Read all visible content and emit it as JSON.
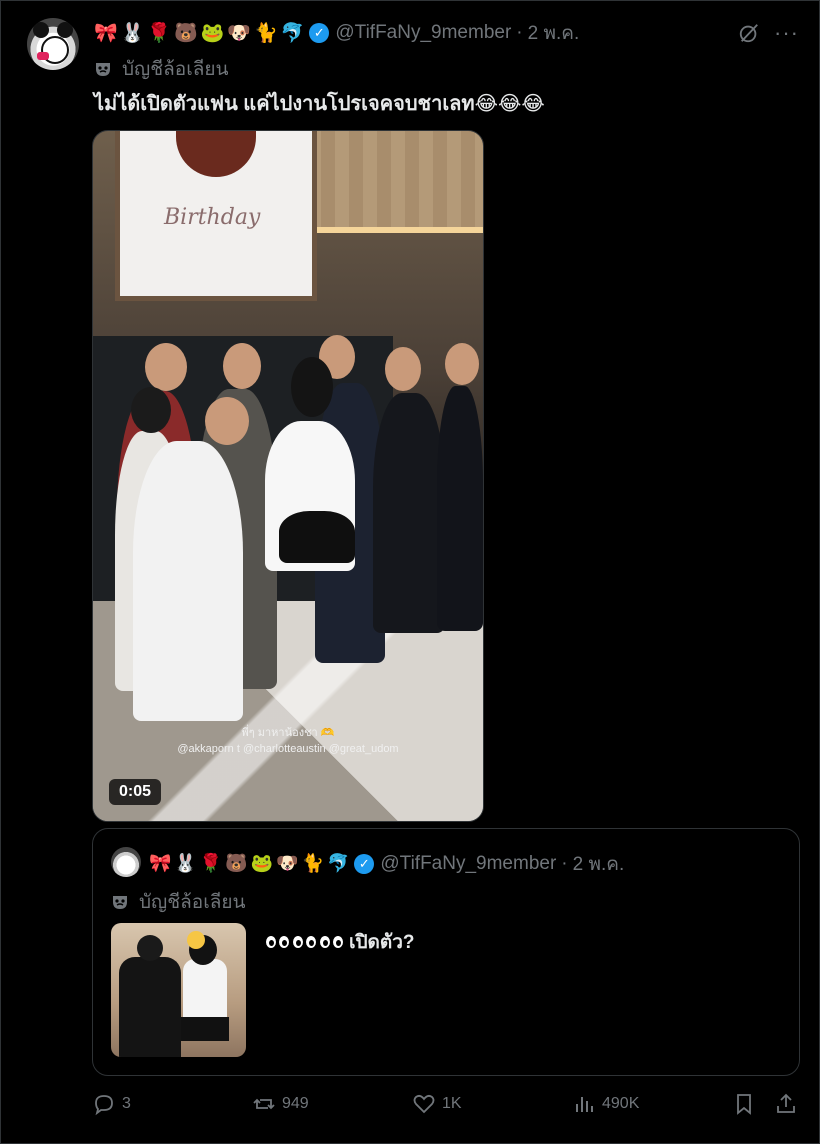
{
  "tweet": {
    "emojis": [
      "🎀",
      "🐰",
      "🌹",
      "🐻",
      "🐸",
      "🐶",
      "🐈",
      "🐬"
    ],
    "handle": "@TifFaNy_9member",
    "separator": "·",
    "time": "2 พ.ค.",
    "account_label": "บัญชีล้อเลียน",
    "text": "ไม่ได้เปิดตัวแฟน แค่ไปงานโปรเจคจบชาเลท😂😂😂",
    "media": {
      "billboard_text": "Birthday",
      "caption_line1": "พี่ๆ มาหาน้องชา 🫶",
      "caption_line2": "@akkaporn t @charlotteaustin @great_udom",
      "duration": "0:05"
    }
  },
  "quoted": {
    "emojis": [
      "🎀",
      "🐰",
      "🌹",
      "🐻",
      "🐸",
      "🐶",
      "🐈",
      "🐬"
    ],
    "handle": "@TifFaNy_9member",
    "separator": "·",
    "time": "2 พ.ค.",
    "account_label": "บัญชีล้อเลียน",
    "text": "เปิดตัว?"
  },
  "actions": {
    "replies": "3",
    "reposts": "949",
    "likes": "1K",
    "views": "490K"
  },
  "colors": {
    "background": "#000000",
    "text": "#e7e9ea",
    "muted": "#71767b",
    "verified": "#1d9bf0",
    "border": "#2f3336"
  }
}
